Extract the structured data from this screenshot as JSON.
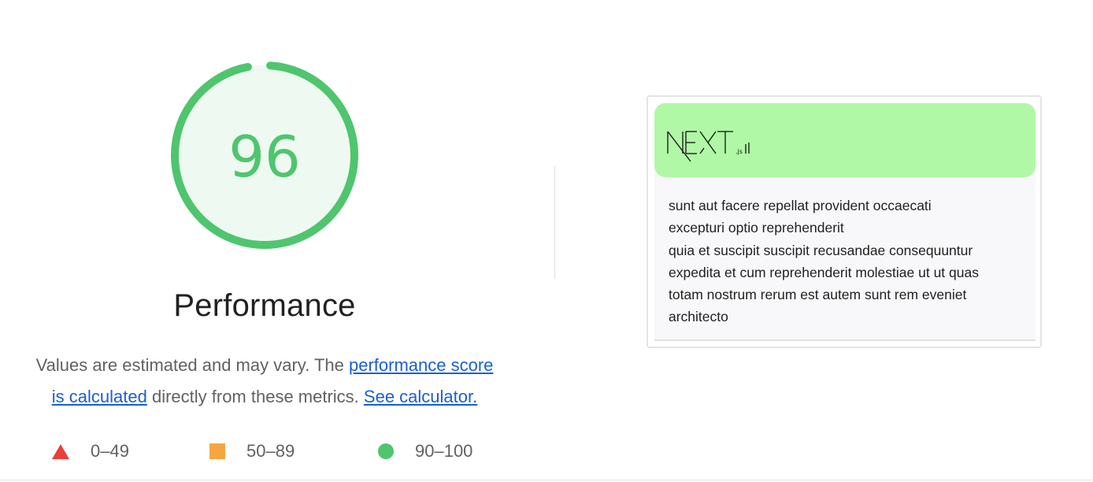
{
  "score": {
    "value": "96",
    "fraction": 0.96,
    "color": "#4fc56e"
  },
  "category": {
    "title": "Performance"
  },
  "description": {
    "prefix": "Values are estimated and may vary. The ",
    "link_score_line1": "performance score",
    "link_score_line2": "is calculated",
    "middle": " directly from these metrics. ",
    "link_calculator": "See calculator."
  },
  "legend": [
    {
      "icon": "triangle-icon",
      "color": "#eb3f3a",
      "label": "0–49"
    },
    {
      "icon": "square-icon",
      "color": "#f4a741",
      "label": "50–89"
    },
    {
      "icon": "circle-icon",
      "color": "#4fc56e",
      "label": "90–100"
    }
  ],
  "screenshot": {
    "logo_text": "NEXT",
    "logo_suffix": ".js",
    "header_color": "#b0f8a6",
    "post_lines": [
      "sunt aut facere repellat provident occaecati",
      "excepturi optio reprehenderit",
      "quia et suscipit suscipit recusandae consequuntur",
      "expedita et cum reprehenderit molestiae ut ut quas",
      "totam nostrum rerum est autem sunt rem eveniet",
      "architecto"
    ]
  }
}
